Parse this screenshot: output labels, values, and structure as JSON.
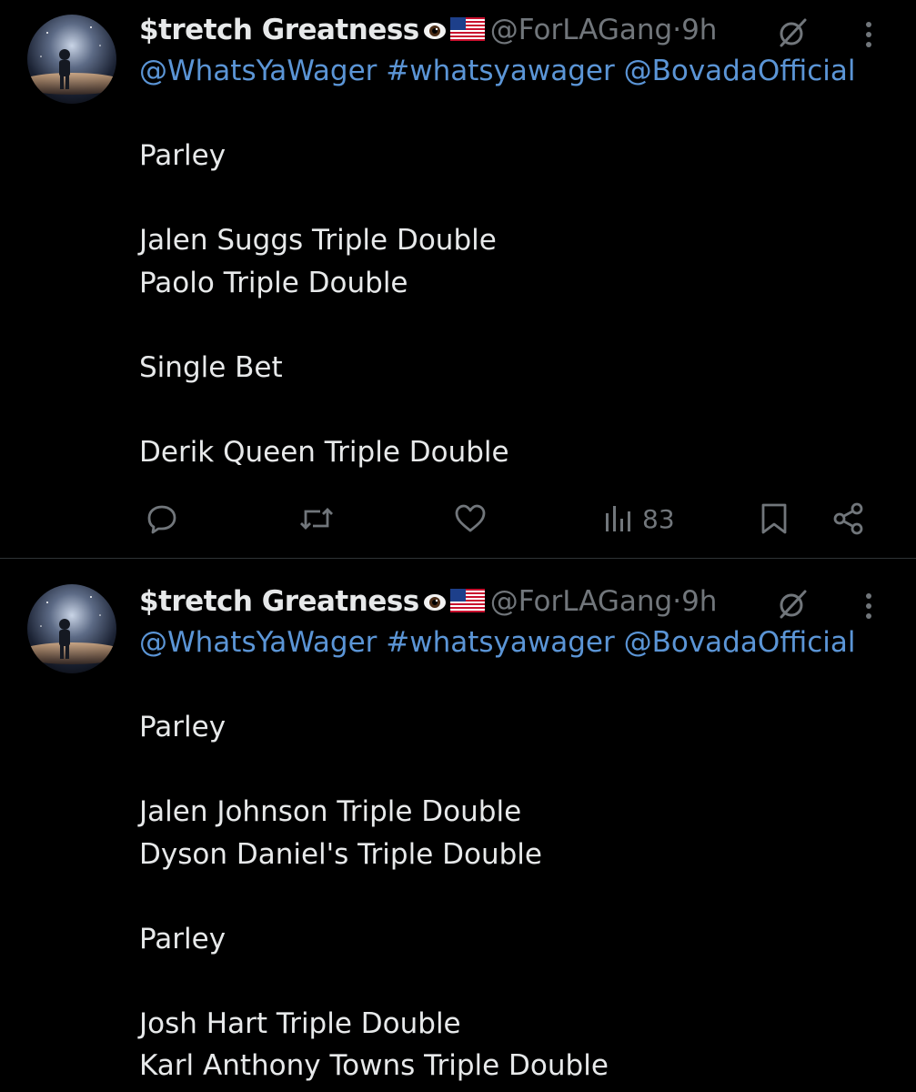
{
  "tweets": [
    {
      "author": {
        "display_name": "$tretch Greatness",
        "badges": [
          "eye-icon",
          "us-flag-icon"
        ],
        "handle": "@ForLAGang",
        "separator": "·",
        "time": "9h"
      },
      "mentions": "@WhatsYaWager #whatsyawager @BovadaOfficial",
      "body": "Parley\n\nJalen Suggs Triple Double\nPaolo Triple Double\n\nSingle Bet\n\nDerik Queen Triple Double",
      "actions": {
        "icons": [
          "reply-icon",
          "retweet-icon",
          "like-icon",
          "views-icon",
          "bookmark-icon",
          "share-icon"
        ],
        "views": "83"
      }
    },
    {
      "author": {
        "display_name": "$tretch Greatness",
        "badges": [
          "eye-icon",
          "us-flag-icon"
        ],
        "handle": "@ForLAGang",
        "separator": "·",
        "time": "9h"
      },
      "mentions": "@WhatsYaWager #whatsyawager @BovadaOfficial",
      "body": "Parley\n\nJalen Johnson Triple Double\nDyson Daniel's Triple Double\n\nParley\n\nJosh Hart Triple Double\nKarl Anthony Towns Triple Double"
    }
  ],
  "colors": {
    "background": "#000000",
    "text": "#e7e9ea",
    "secondary": "#71767b",
    "link": "#5b95d6",
    "divider": "#2f3336"
  }
}
